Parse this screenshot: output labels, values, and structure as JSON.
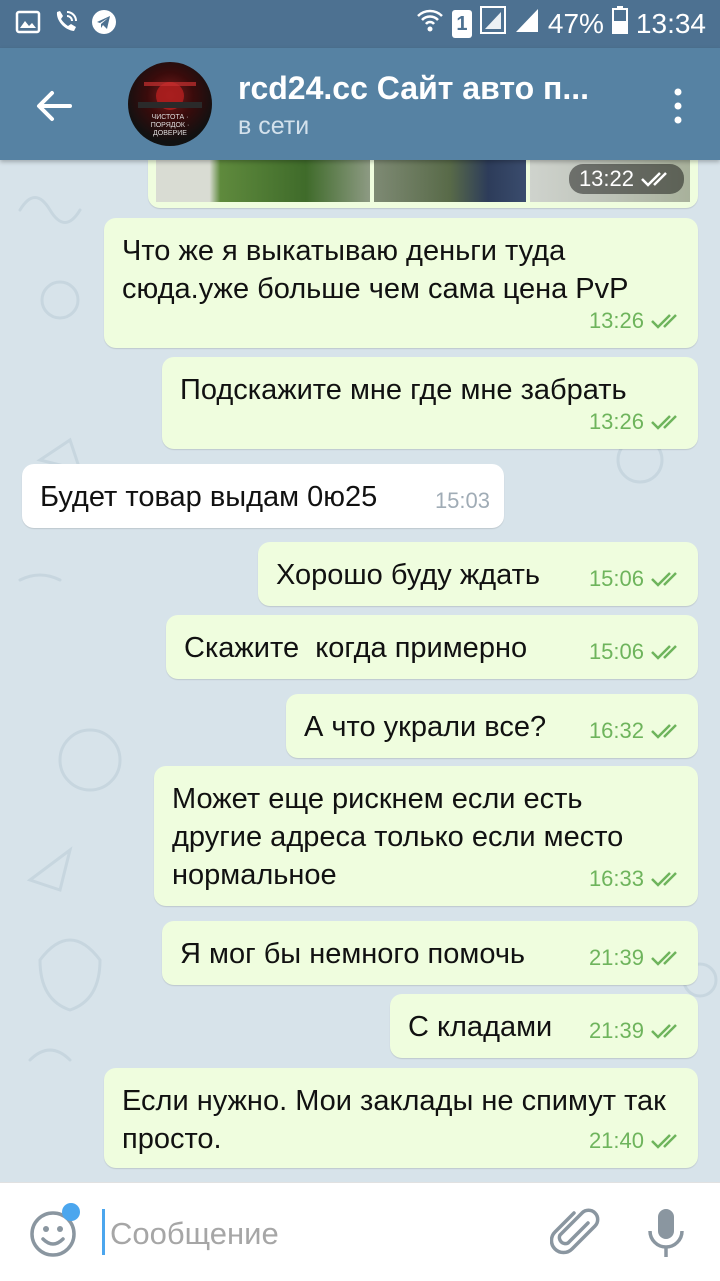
{
  "status_bar": {
    "battery": "47%",
    "time": "13:34",
    "sim": "1",
    "icons": [
      "gallery-icon",
      "wifi-calling-icon",
      "telegram-icon",
      "wifi-icon",
      "sim-signal-icon",
      "signal-icon",
      "battery-icon"
    ]
  },
  "header": {
    "title": "rcd24.cc Сайт авто п...",
    "status": "в сети",
    "avatar_text": "ЧИСТОТА · ПОРЯДОК · ДОВЕРИЕ"
  },
  "photo_message": {
    "time": "13:22"
  },
  "messages": [
    {
      "dir": "out",
      "text": "Что же я выкатываю деньги туда сюда.уже больше чем сама цена PvP",
      "time": "13:26"
    },
    {
      "dir": "out",
      "text": "Подскажите мне где мне забрать",
      "time": "13:26"
    },
    {
      "dir": "in",
      "text": "Будет товар выдам 0ю25",
      "time": "15:03"
    },
    {
      "dir": "out",
      "text": "Хорошо буду ждать",
      "time": "15:06"
    },
    {
      "dir": "out",
      "text": "Скажите  когда примерно",
      "time": "15:06"
    },
    {
      "dir": "out",
      "text": "А что украли все?",
      "time": "16:32"
    },
    {
      "dir": "out",
      "text": "Может еще рискнем если есть другие адреса только если место нормальное",
      "time": "16:33"
    },
    {
      "dir": "out",
      "text": "Я мог бы немного помочь",
      "time": "21:39"
    },
    {
      "dir": "out",
      "text": "С кладами",
      "time": "21:39"
    },
    {
      "dir": "out",
      "text": "Если нужно. Мои заклады не спимут так просто.",
      "time": "21:40"
    }
  ],
  "input": {
    "placeholder": "Сообщение"
  },
  "colors": {
    "status_bar": "#4d7191",
    "header": "#5682a3",
    "outgoing_bubble": "#effdde",
    "incoming_bubble": "#ffffff",
    "time_outgoing": "#6eb45c",
    "accent": "#4ba6ee"
  }
}
